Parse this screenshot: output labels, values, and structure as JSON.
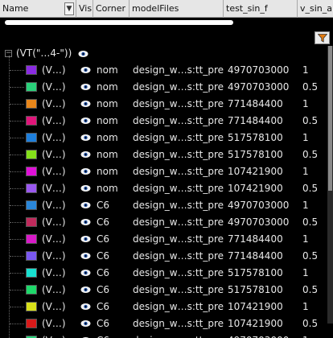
{
  "columns": [
    {
      "key": "name",
      "label": "Name"
    },
    {
      "key": "vis",
      "label": "Vis"
    },
    {
      "key": "corner",
      "label": "Corner"
    },
    {
      "key": "model",
      "label": "modelFiles"
    },
    {
      "key": "freq",
      "label": "test_sin_f"
    },
    {
      "key": "amp",
      "label": "v_sin_ar"
    }
  ],
  "group": {
    "label": "(VT(\"…4-\"))",
    "icon": "eye-icon"
  },
  "rows": [
    {
      "name": "(V…)",
      "color": "#8a2be2",
      "corner": "nom",
      "model": "design_w…s:tt_pre",
      "freq": "4970703000",
      "amp": "1"
    },
    {
      "name": "(V…)",
      "color": "#2ad07a",
      "corner": "nom",
      "model": "design_w…s:tt_pre",
      "freq": "4970703000",
      "amp": "0.5"
    },
    {
      "name": "(V…)",
      "color": "#e8861a",
      "corner": "nom",
      "model": "design_w…s:tt_pre",
      "freq": "771484400",
      "amp": "1"
    },
    {
      "name": "(V…)",
      "color": "#e0157a",
      "corner": "nom",
      "model": "design_w…s:tt_pre",
      "freq": "771484400",
      "amp": "0.5"
    },
    {
      "name": "(V…)",
      "color": "#1e7fdc",
      "corner": "nom",
      "model": "design_w…s:tt_pre",
      "freq": "517578100",
      "amp": "1"
    },
    {
      "name": "(V…)",
      "color": "#84e01a",
      "corner": "nom",
      "model": "design_w…s:tt_pre",
      "freq": "517578100",
      "amp": "0.5"
    },
    {
      "name": "(V…)",
      "color": "#e010d8",
      "corner": "nom",
      "model": "design_w…s:tt_pre",
      "freq": "107421900",
      "amp": "1"
    },
    {
      "name": "(V…)",
      "color": "#9a58f0",
      "corner": "nom",
      "model": "design_w…s:tt_pre",
      "freq": "107421900",
      "amp": "0.5"
    },
    {
      "name": "(V…)",
      "color": "#2a86d8",
      "corner": "C6",
      "model": "design_w…s:tt_pre",
      "freq": "4970703000",
      "amp": "1"
    },
    {
      "name": "(V…)",
      "color": "#c02a5c",
      "corner": "C6",
      "model": "design_w…s:tt_pre",
      "freq": "4970703000",
      "amp": "0.5"
    },
    {
      "name": "(V…)",
      "color": "#d81ac8",
      "corner": "C6",
      "model": "design_w…s:tt_pre",
      "freq": "771484400",
      "amp": "1"
    },
    {
      "name": "(V…)",
      "color": "#7a58f0",
      "corner": "C6",
      "model": "design_w…s:tt_pre",
      "freq": "771484400",
      "amp": "0.5"
    },
    {
      "name": "(V…)",
      "color": "#18e0d0",
      "corner": "C6",
      "model": "design_w…s:tt_pre",
      "freq": "517578100",
      "amp": "1"
    },
    {
      "name": "(V…)",
      "color": "#1ed86a",
      "corner": "C6",
      "model": "design_w…s:tt_pre",
      "freq": "517578100",
      "amp": "0.5"
    },
    {
      "name": "(V…)",
      "color": "#d8e01a",
      "corner": "C6",
      "model": "design_w…s:tt_pre",
      "freq": "107421900",
      "amp": "1"
    },
    {
      "name": "(V…)",
      "color": "#d81a1a",
      "corner": "C6",
      "model": "design_w…s:tt_pre",
      "freq": "107421900",
      "amp": "0.5"
    },
    {
      "name": "(V…)",
      "color": "#2ad07a",
      "corner": "C6",
      "model": "design_w…s:tt_pre",
      "freq": "4970703000",
      "amp": "1"
    }
  ]
}
